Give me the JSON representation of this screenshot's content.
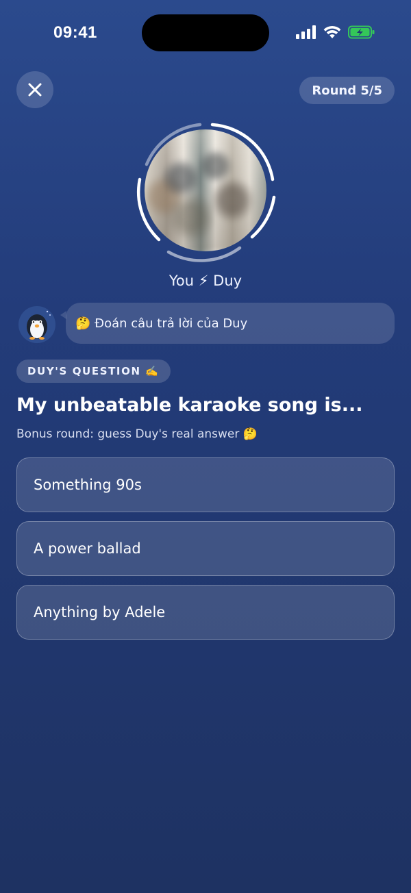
{
  "status_bar": {
    "time": "09:41",
    "icons": [
      "signal-icon",
      "wifi-icon",
      "battery-charging-icon"
    ]
  },
  "header": {
    "close_icon": "close-icon",
    "round_label": "Round 5/5"
  },
  "match": {
    "versus_label": "You ⚡ Duy"
  },
  "assistant": {
    "mascot": "penguin-mascot-icon",
    "message": "🤔 Đoán câu trả lời của Duy"
  },
  "question": {
    "tag": "DUY'S QUESTION ✍️",
    "title": "My unbeatable karaoke song is...",
    "subtitle": "Bonus round: guess Duy's real answer 🤔"
  },
  "options": [
    {
      "label": "Something 90s"
    },
    {
      "label": "A power ballad"
    },
    {
      "label": "Anything by Adele"
    }
  ],
  "colors": {
    "background_top": "#2b4a8d",
    "background_bottom": "#1e3262",
    "battery_green": "#34c759"
  }
}
